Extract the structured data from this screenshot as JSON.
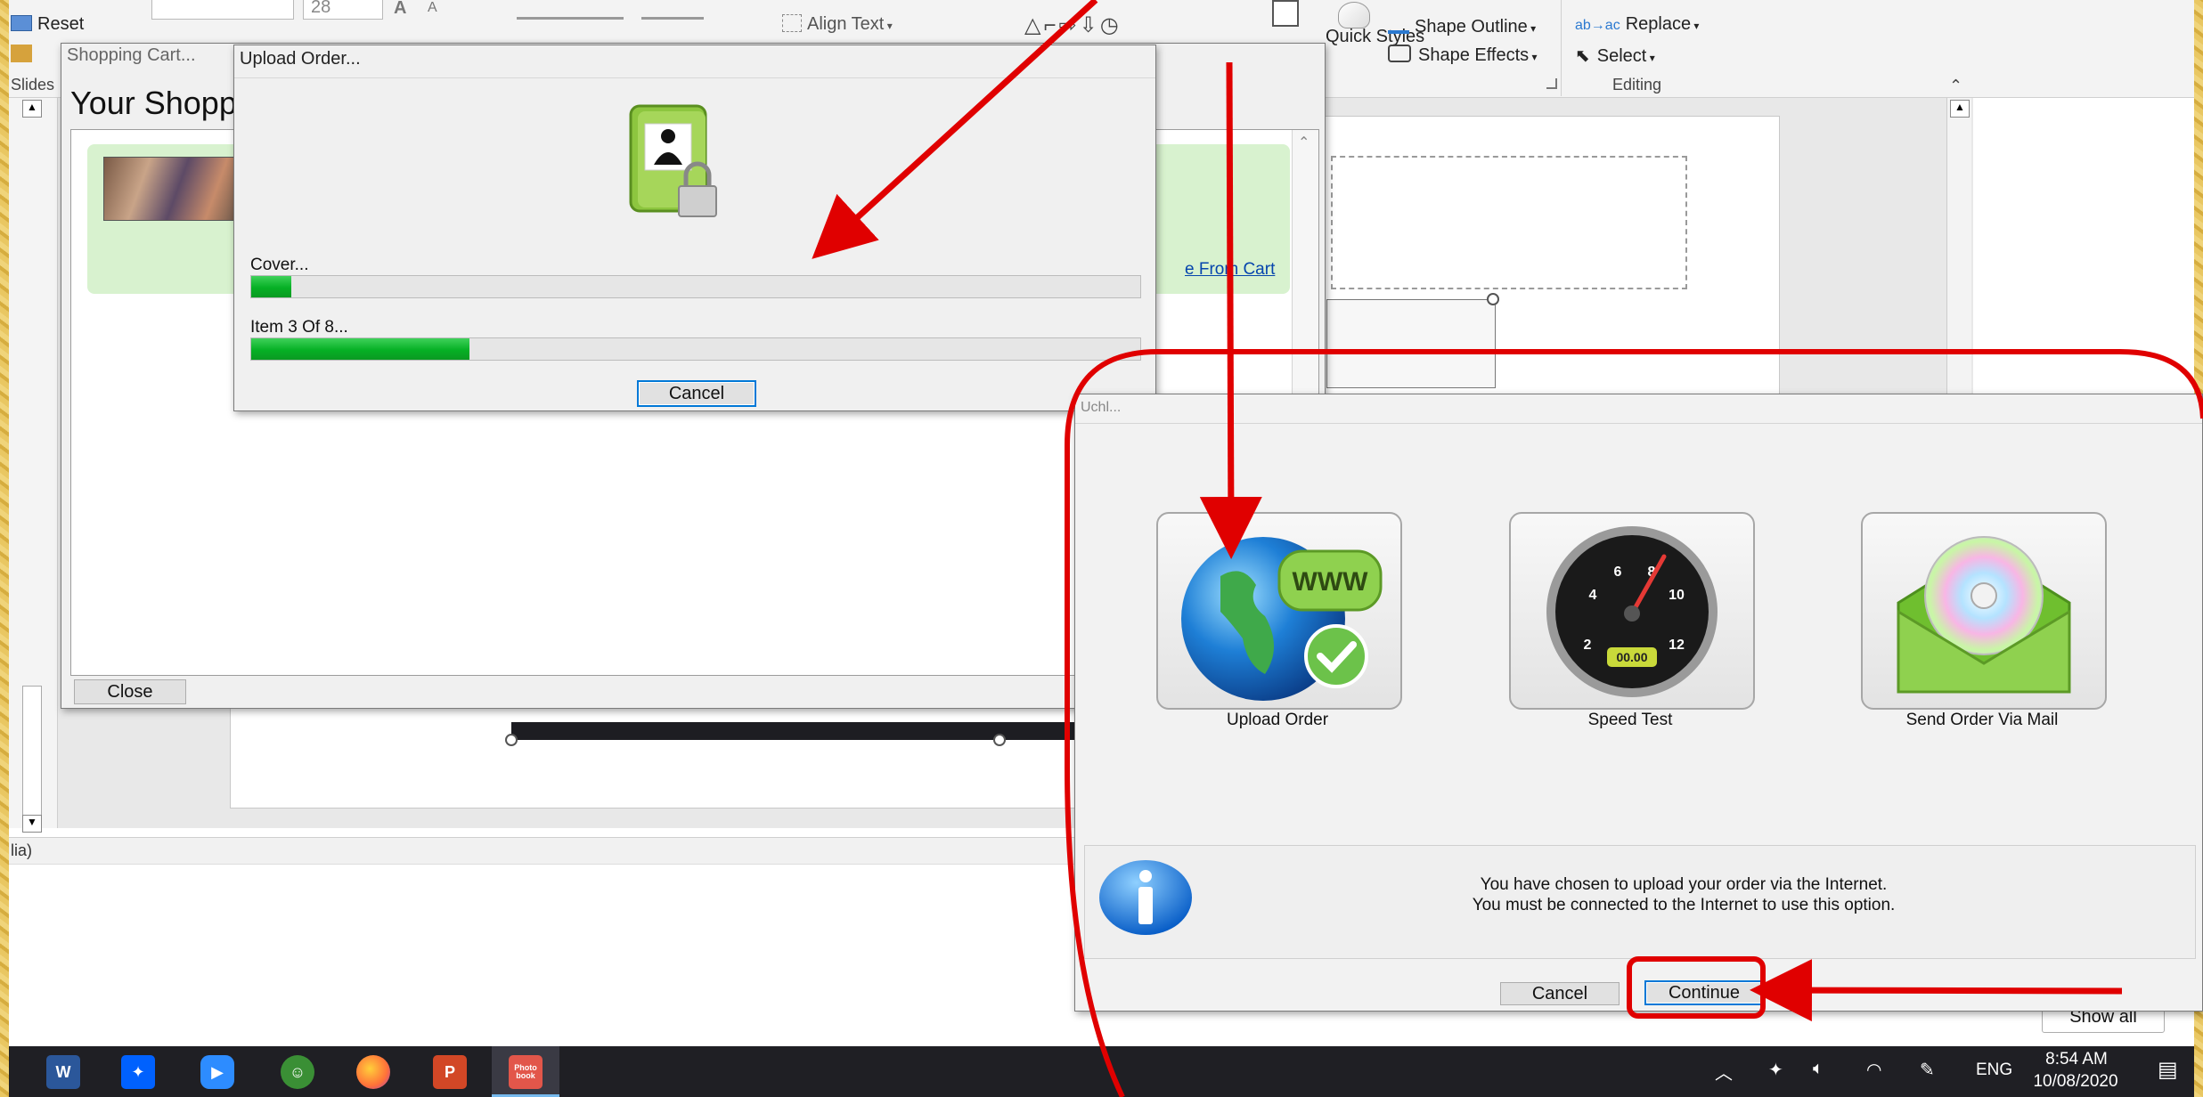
{
  "ppt": {
    "ribbon": {
      "reset": "Reset",
      "font_size": "28",
      "align_text": "Align Text",
      "quick_styles": "Quick Styles",
      "shape_outline": "Shape Outline",
      "shape_effects": "Shape Effects",
      "replace": "Replace",
      "select": "Select",
      "editing_group": "Editing"
    },
    "slides_label": "Slides",
    "status_fragment": "lia)",
    "show_all": "Show all"
  },
  "shopping_cart": {
    "title": "Shopping Cart...",
    "heading": "Your Shopp",
    "remove_link": "e From Cart",
    "close_button": "Close"
  },
  "upload_dialog": {
    "title": "Upload Order...",
    "cover_label": "Cover...",
    "cover_progress": 0.045,
    "item_label": "Item 3 Of 8...",
    "item_progress": 0.245,
    "cancel_button": "Cancel"
  },
  "order_dialog": {
    "title_fragment": "Uchl...",
    "options": [
      {
        "label": "Upload Order",
        "icon": "globe-www-icon"
      },
      {
        "label": "Speed Test",
        "icon": "speedometer-icon"
      },
      {
        "label": "Send Order Via Mail",
        "icon": "cd-envelope-icon"
      }
    ],
    "speed_readout": "00.00",
    "info_line1": "You have chosen to upload your order via the Internet.",
    "info_line2": "You must be connected to the Internet to use this option.",
    "cancel_button": "Cancel",
    "continue_button": "Continue"
  },
  "taskbar": {
    "lang": "ENG",
    "time": "8:54 AM",
    "date": "10/08/2020",
    "apps": [
      "word-icon",
      "dropbox-icon",
      "zoom-icon",
      "android-icon",
      "firefox-icon",
      "powerpoint-icon",
      "photobook-icon"
    ],
    "photobook_label": "Photo book",
    "word_letter": "W",
    "ppt_letter": "P"
  },
  "colors": {
    "annotation_red": "#e00000",
    "progress_green": "#06b025",
    "focus_blue": "#0078d7",
    "taskbar": "#1f1f24"
  }
}
